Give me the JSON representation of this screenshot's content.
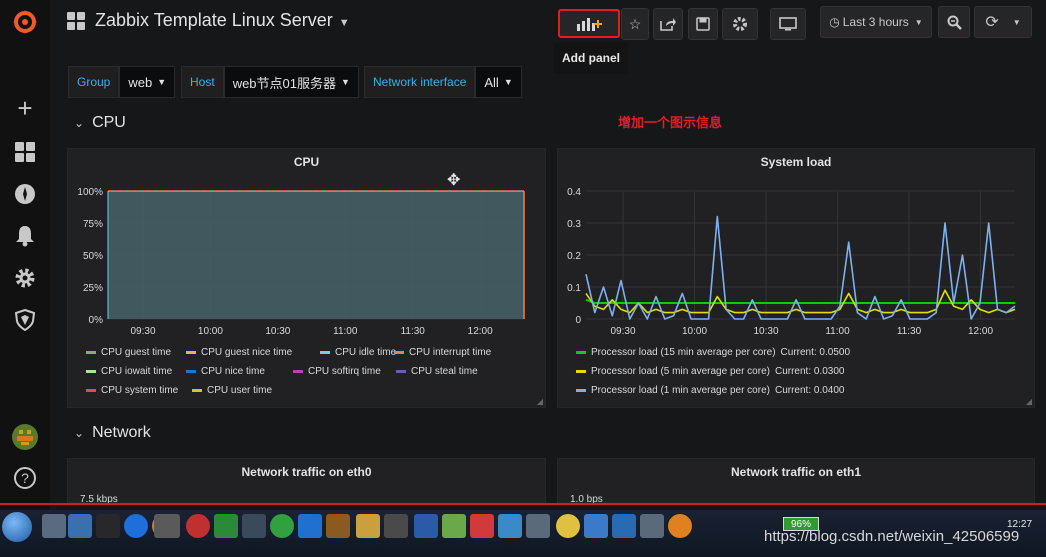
{
  "header": {
    "title": "Zabbix Template Linux Server",
    "time_range": "Last 3 hours",
    "tooltip": "Add panel"
  },
  "variables": [
    {
      "label": "Group",
      "value": "web"
    },
    {
      "label": "Host",
      "value": "web节点01服务器"
    },
    {
      "label": "Network interface",
      "value": "All"
    }
  ],
  "annotation": "增加一个图示信息",
  "rows": {
    "cpu": "CPU",
    "network": "Network"
  },
  "panels": {
    "cpu": {
      "title": "CPU"
    },
    "sysload": {
      "title": "System load"
    },
    "eth0": {
      "title": "Network traffic on eth0",
      "first_tick": "7.5 kbps"
    },
    "eth1": {
      "title": "Network traffic on eth1",
      "first_tick": "1.0 bps"
    }
  },
  "chart_data": [
    {
      "type": "area",
      "title": "CPU",
      "x": [
        "09:30",
        "10:00",
        "10:30",
        "11:00",
        "11:30",
        "12:00"
      ],
      "ytick_labels": [
        "0%",
        "25%",
        "50%",
        "75%",
        "100%"
      ],
      "ylim": [
        0,
        100
      ],
      "legend": [
        {
          "name": "CPU guest time",
          "color": "#7eb26d"
        },
        {
          "name": "CPU guest nice time",
          "color": "#eab839"
        },
        {
          "name": "CPU idle time",
          "color": "#6ed0e0"
        },
        {
          "name": "CPU interrupt time",
          "color": "#ef843c"
        },
        {
          "name": "CPU iowait time",
          "color": "#b7dbab"
        },
        {
          "name": "CPU nice time",
          "color": "#1f78c1"
        },
        {
          "name": "CPU softirq time",
          "color": "#ba43a9"
        },
        {
          "name": "CPU steal time",
          "color": "#705da0"
        },
        {
          "name": "CPU system time",
          "color": "#e24d42"
        },
        {
          "name": "CPU user time",
          "color": "#eab839"
        }
      ],
      "series": [
        {
          "name": "CPU idle time",
          "values": [
            100,
            100,
            100,
            100,
            100,
            100
          ]
        }
      ]
    },
    {
      "type": "line",
      "title": "System load",
      "x": [
        "09:30",
        "10:00",
        "10:30",
        "11:00",
        "11:30",
        "12:00"
      ],
      "ytick_labels": [
        "0",
        "0.1",
        "0.2",
        "0.3",
        "0.4"
      ],
      "ylim": [
        0,
        0.4
      ],
      "series": [
        {
          "name": "Processor load (15 min average per core)",
          "current": "0.0500",
          "color": "#00d000",
          "values": [
            0.06,
            0.05,
            0.05,
            0.05,
            0.05,
            0.05,
            0.05,
            0.05,
            0.05,
            0.05,
            0.05,
            0.05,
            0.05,
            0.05,
            0.05,
            0.05,
            0.05,
            0.05,
            0.05,
            0.05,
            0.05,
            0.05,
            0.05,
            0.05,
            0.05,
            0.05,
            0.05,
            0.05,
            0.05,
            0.05,
            0.05,
            0.05,
            0.05,
            0.05,
            0.05,
            0.05,
            0.05,
            0.05,
            0.05,
            0.05,
            0.05,
            0.05,
            0.05,
            0.05,
            0.05,
            0.05,
            0.05,
            0.05,
            0.05,
            0.05
          ]
        },
        {
          "name": "Processor load (5 min average per core)",
          "current": "0.0300",
          "color": "#e0e000",
          "values": [
            0.08,
            0.04,
            0.03,
            0.06,
            0.03,
            0.02,
            0.05,
            0.02,
            0.03,
            0.02,
            0.02,
            0.03,
            0.02,
            0.02,
            0.02,
            0.07,
            0.03,
            0.02,
            0.02,
            0.03,
            0.02,
            0.02,
            0.02,
            0.02,
            0.03,
            0.02,
            0.02,
            0.02,
            0.02,
            0.03,
            0.08,
            0.03,
            0.02,
            0.03,
            0.02,
            0.02,
            0.03,
            0.02,
            0.02,
            0.02,
            0.03,
            0.09,
            0.04,
            0.03,
            0.06,
            0.03,
            0.02,
            0.03,
            0.02,
            0.03
          ]
        },
        {
          "name": "Processor load (1 min average per core)",
          "current": "0.0400",
          "color": "#7eb0ef",
          "values": [
            0.14,
            0.02,
            0.1,
            0.01,
            0.12,
            0.0,
            0.05,
            0.0,
            0.07,
            0.0,
            0.01,
            0.08,
            0.0,
            0.0,
            0.0,
            0.32,
            0.03,
            0.0,
            0.0,
            0.06,
            0.0,
            0.0,
            0.0,
            0.0,
            0.06,
            0.0,
            0.0,
            0.0,
            0.0,
            0.04,
            0.24,
            0.02,
            0.0,
            0.07,
            0.0,
            0.01,
            0.06,
            0.0,
            0.0,
            0.0,
            0.02,
            0.3,
            0.05,
            0.2,
            0.0,
            0.05,
            0.3,
            0.03,
            0.02,
            0.04
          ]
        }
      ]
    }
  ]
}
